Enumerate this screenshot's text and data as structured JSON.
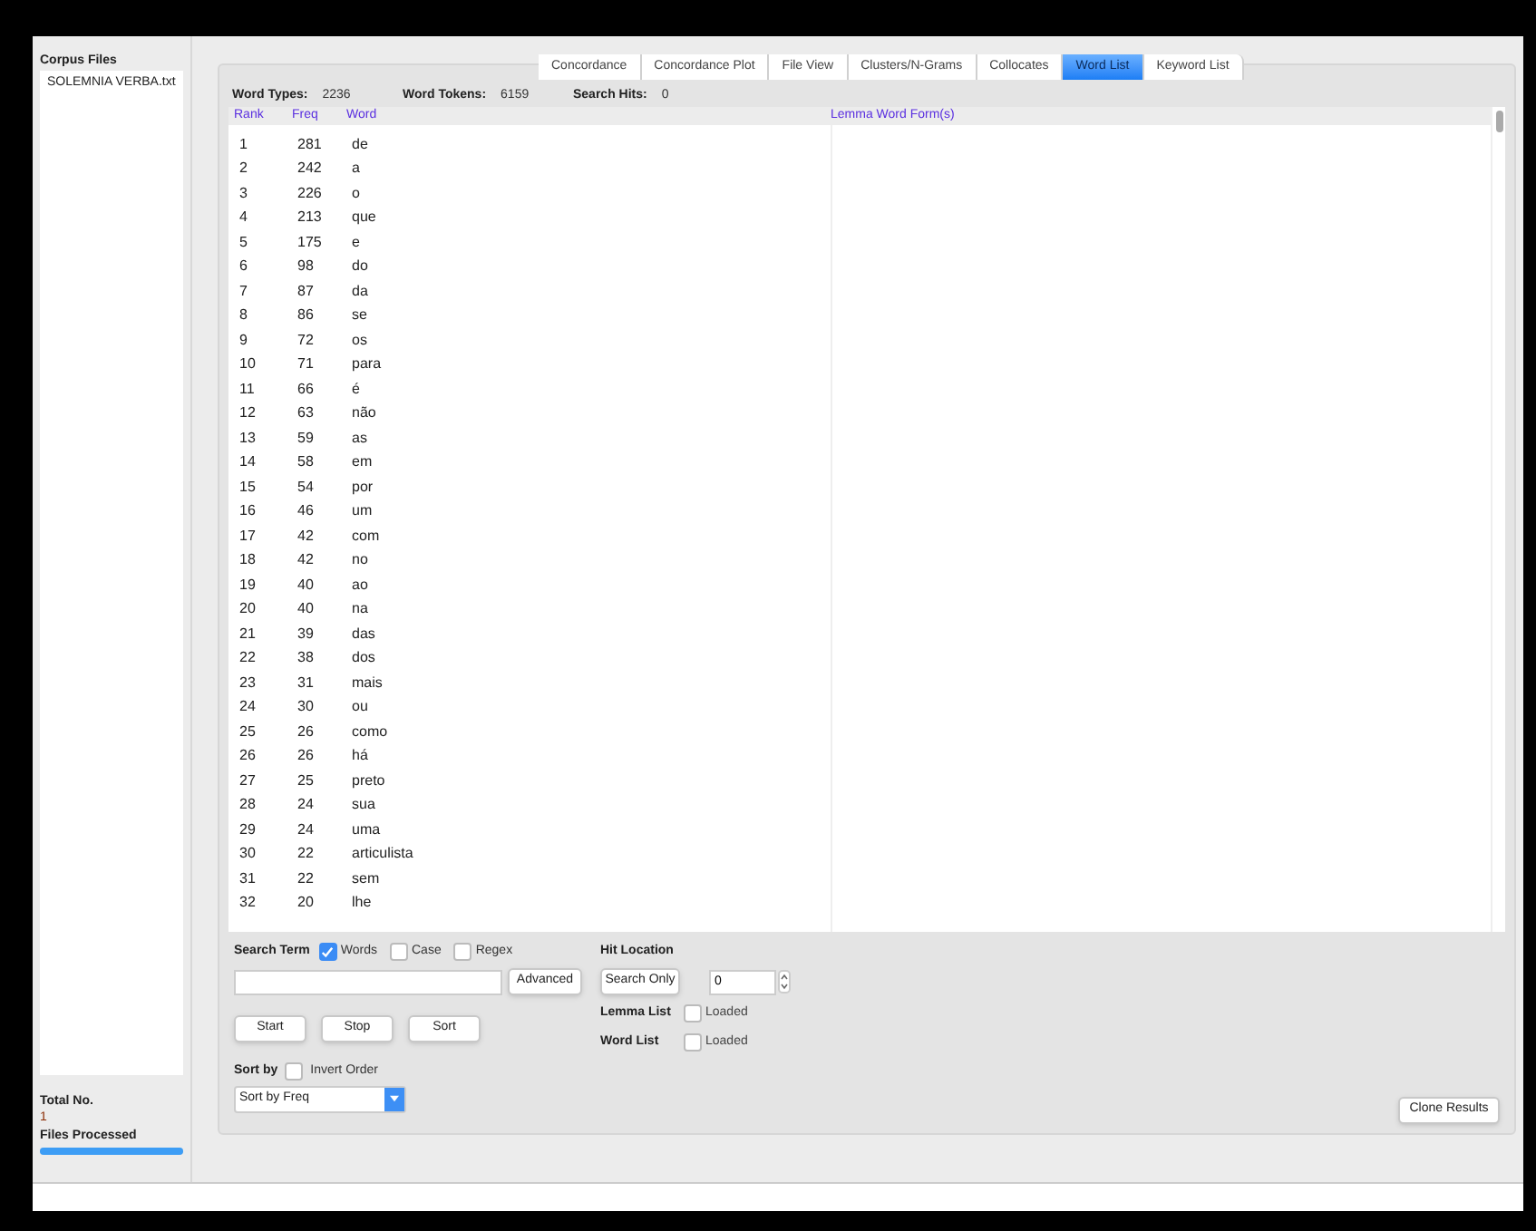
{
  "sidebar": {
    "title": "Corpus Files",
    "files": [
      "SOLEMNIA VERBA.txt"
    ],
    "total_label": "Total No.",
    "total_value": "1",
    "processed_label": "Files Processed",
    "progress": {
      "level": 1
    }
  },
  "tabs": [
    {
      "label": "Concordance",
      "selected": false
    },
    {
      "label": "Concordance Plot",
      "selected": false
    },
    {
      "label": "File View",
      "selected": false
    },
    {
      "label": "Clusters/N-Grams",
      "selected": false
    },
    {
      "label": "Collocates",
      "selected": false
    },
    {
      "label": "Word List",
      "selected": true
    },
    {
      "label": "Keyword List",
      "selected": false
    }
  ],
  "stats": [
    {
      "label": "Word Types:",
      "value": "2236"
    },
    {
      "label": "Word Tokens:",
      "value": "6159"
    },
    {
      "label": "Search Hits:",
      "value": "0"
    }
  ],
  "table": {
    "columns": [
      "Rank",
      "Freq",
      "Word",
      "Lemma Word Form(s)"
    ],
    "rows": [
      [
        "1",
        "281",
        "de"
      ],
      [
        "2",
        "242",
        "a"
      ],
      [
        "3",
        "226",
        "o"
      ],
      [
        "4",
        "213",
        "que"
      ],
      [
        "5",
        "175",
        "e"
      ],
      [
        "6",
        "98",
        "do"
      ],
      [
        "7",
        "87",
        "da"
      ],
      [
        "8",
        "86",
        "se"
      ],
      [
        "9",
        "72",
        "os"
      ],
      [
        "10",
        "71",
        "para"
      ],
      [
        "11",
        "66",
        "é"
      ],
      [
        "12",
        "63",
        "não"
      ],
      [
        "13",
        "59",
        "as"
      ],
      [
        "14",
        "58",
        "em"
      ],
      [
        "15",
        "54",
        "por"
      ],
      [
        "16",
        "46",
        "um"
      ],
      [
        "17",
        "42",
        "com"
      ],
      [
        "18",
        "42",
        "no"
      ],
      [
        "19",
        "40",
        "ao"
      ],
      [
        "20",
        "40",
        "na"
      ],
      [
        "21",
        "39",
        "das"
      ],
      [
        "22",
        "38",
        "dos"
      ],
      [
        "23",
        "31",
        "mais"
      ],
      [
        "24",
        "30",
        "ou"
      ],
      [
        "25",
        "26",
        "como"
      ],
      [
        "26",
        "26",
        "há"
      ],
      [
        "27",
        "25",
        "preto"
      ],
      [
        "28",
        "24",
        "sua"
      ],
      [
        "29",
        "24",
        "uma"
      ],
      [
        "30",
        "22",
        "articulista"
      ],
      [
        "31",
        "22",
        "sem"
      ],
      [
        "32",
        "20",
        "lhe"
      ]
    ]
  },
  "search": {
    "label": "Search Term",
    "options": [
      {
        "label": "Words",
        "checked": true
      },
      {
        "label": "Case",
        "checked": false
      },
      {
        "label": "Regex",
        "checked": false
      }
    ],
    "advanced": "Advanced"
  },
  "actions": [
    "Start",
    "Stop",
    "Sort"
  ],
  "sort": {
    "label": "Sort by",
    "invert": {
      "label": "Invert Order",
      "checked": false
    },
    "value": "Sort by Freq"
  },
  "hit": {
    "label": "Hit Location",
    "button": "Search Only",
    "value": "0"
  },
  "lists": [
    {
      "label": "Lemma List",
      "status": "Loaded",
      "checked": false
    },
    {
      "label": "Word List",
      "status": "Loaded",
      "checked": false
    }
  ],
  "clone": "Clone Results"
}
